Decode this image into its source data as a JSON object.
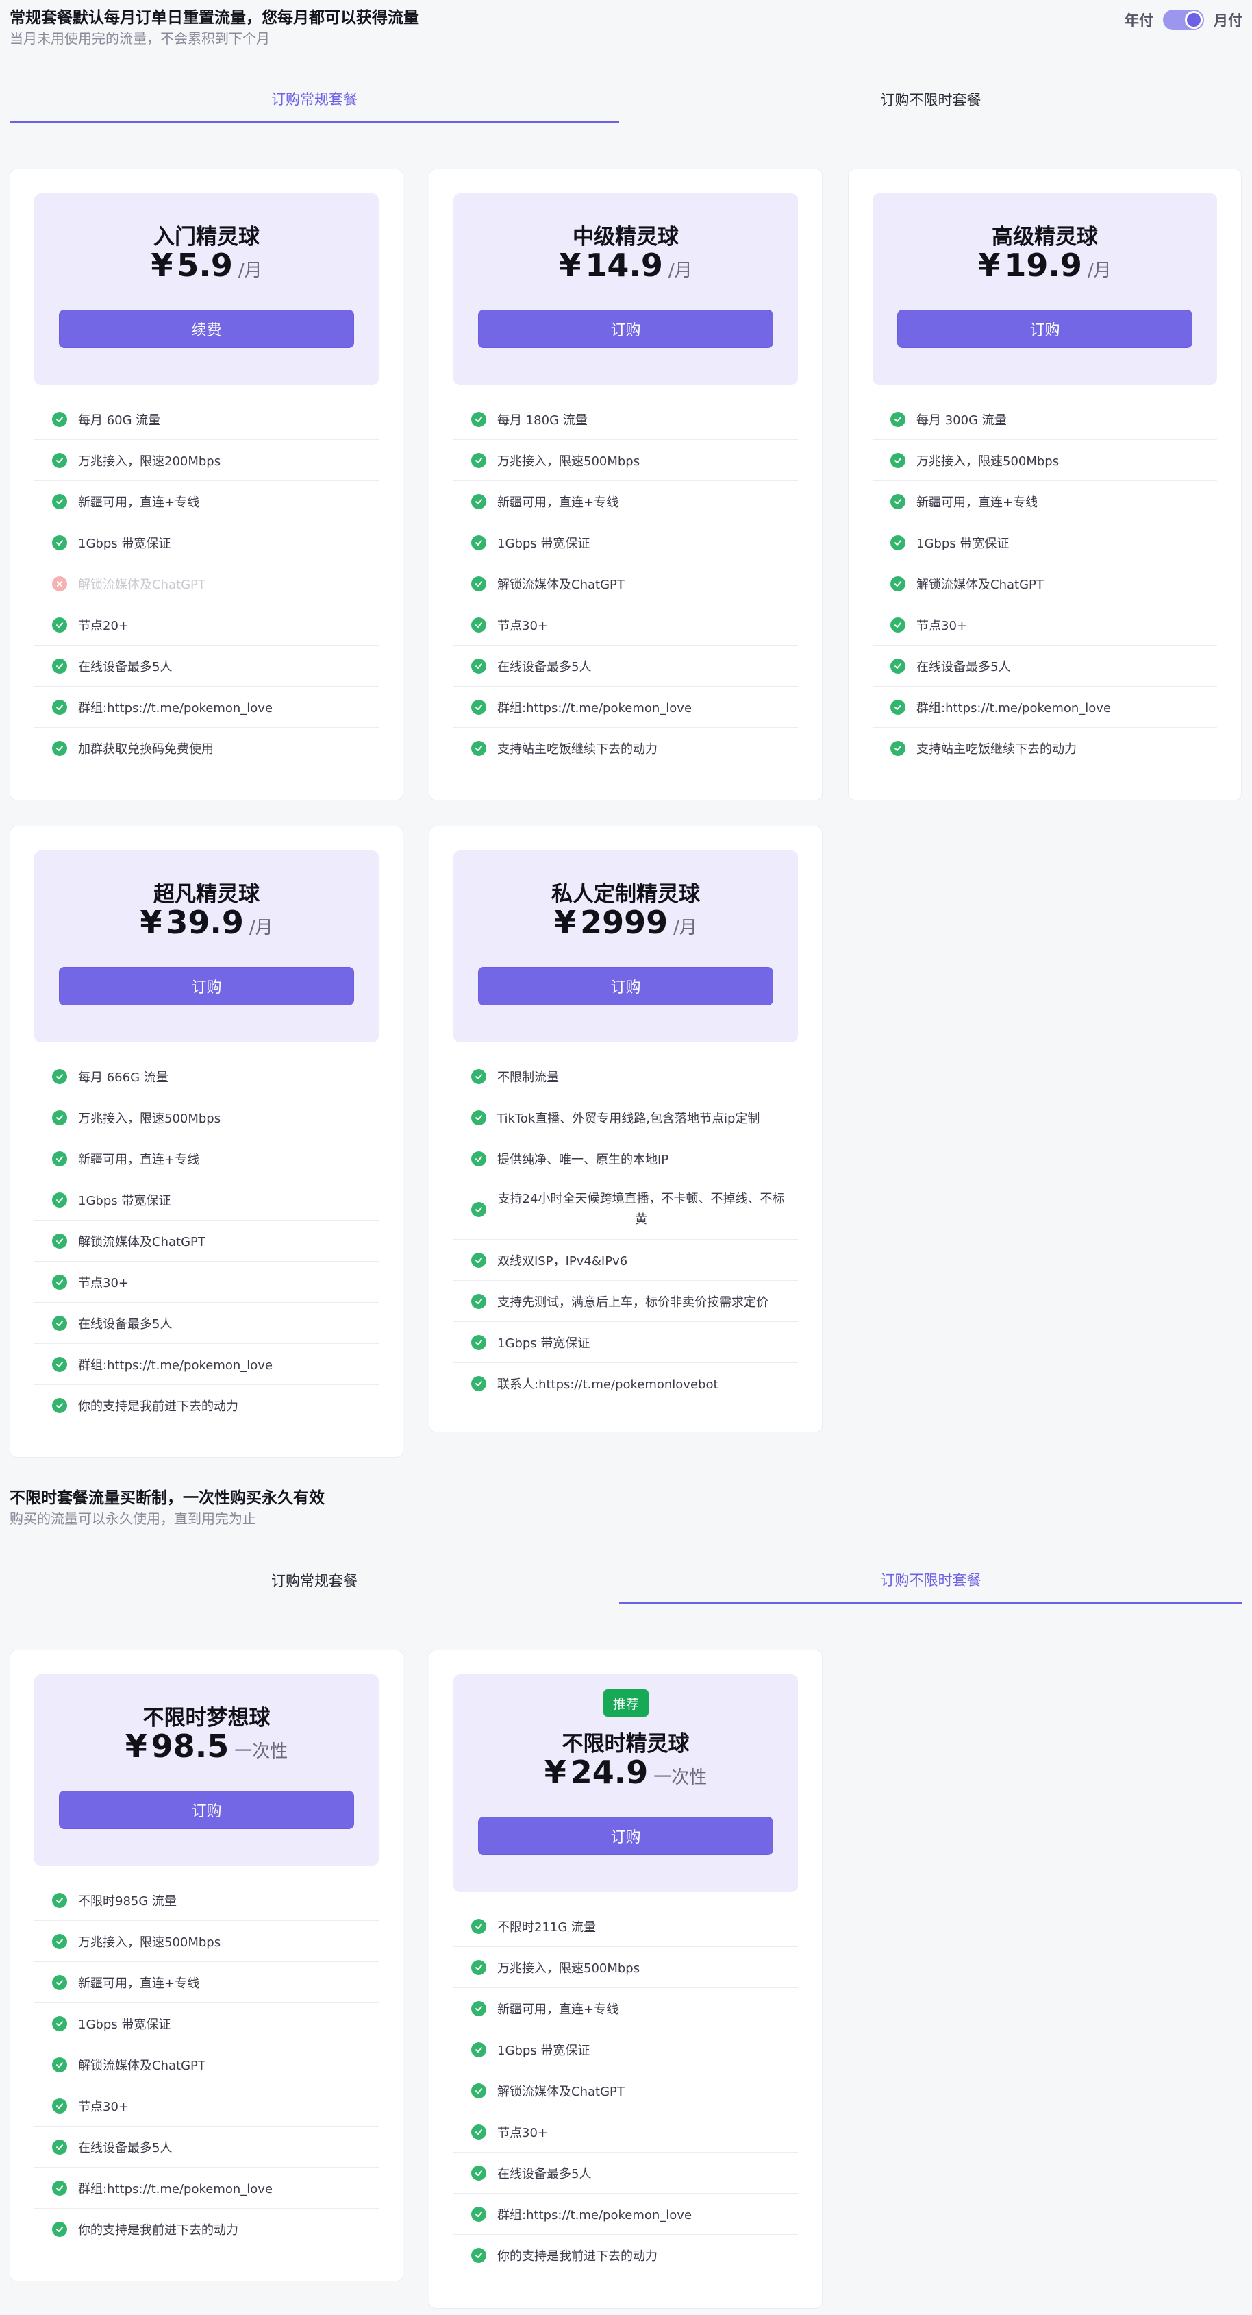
{
  "top": {
    "title": "常规套餐默认每月订单日重置流量，您每月都可以获得流量",
    "subtitle": "当月未用使用完的流量，不会累积到下个月",
    "toggle_left": "年付",
    "toggle_right": "月付"
  },
  "tabs": {
    "regular": "订购常规套餐",
    "unlimited": "订购不限时套餐"
  },
  "regular_plans": [
    {
      "name": "入门精灵球",
      "currency": "¥",
      "price": "5.9",
      "unit": "/月",
      "button": "续费",
      "features": [
        "每月 60G 流量",
        "万兆接入，限速200Mbps",
        "新疆可用，直连+专线",
        "1Gbps 带宽保证",
        "解锁流媒体及ChatGPT",
        "节点20+",
        "在线设备最多5人",
        "群组:https://t.me/pokemon_love",
        "加群获取兑换码免费使用"
      ],
      "disabled_feature": "解锁流媒体及ChatGPT"
    },
    {
      "name": "中级精灵球",
      "currency": "¥",
      "price": "14.9",
      "unit": "/月",
      "button": "订购",
      "features": [
        "每月 180G 流量",
        "万兆接入，限速500Mbps",
        "新疆可用，直连+专线",
        "1Gbps 带宽保证",
        "解锁流媒体及ChatGPT",
        "节点30+",
        "在线设备最多5人",
        "群组:https://t.me/pokemon_love",
        "支持站主吃饭继续下去的动力"
      ]
    },
    {
      "name": "高级精灵球",
      "currency": "¥",
      "price": "19.9",
      "unit": "/月",
      "button": "订购",
      "features": [
        "每月 300G 流量",
        "万兆接入，限速500Mbps",
        "新疆可用，直连+专线",
        "1Gbps 带宽保证",
        "解锁流媒体及ChatGPT",
        "节点30+",
        "在线设备最多5人",
        "群组:https://t.me/pokemon_love",
        "支持站主吃饭继续下去的动力"
      ]
    },
    {
      "name": "超凡精灵球",
      "currency": "¥",
      "price": "39.9",
      "unit": "/月",
      "button": "订购",
      "features": [
        "每月 666G 流量",
        "万兆接入，限速500Mbps",
        "新疆可用，直连+专线",
        "1Gbps 带宽保证",
        "解锁流媒体及ChatGPT",
        "节点30+",
        "在线设备最多5人",
        "群组:https://t.me/pokemon_love",
        "你的支持是我前进下去的动力"
      ]
    },
    {
      "name": "私人定制精灵球",
      "currency": "¥",
      "price": "2999",
      "unit": "/月",
      "button": "订购",
      "features": [
        "不限制流量",
        "TikTok直播、外贸专用线路,包含落地节点ip定制",
        "提供纯净、唯一、原生的本地IP",
        "支持24小时全天候跨境直播，不卡顿、不掉线、不标黄",
        "双线双ISP，IPv4&IPv6",
        "支持先测试，满意后上车，标价非卖价按需求定价",
        "1Gbps 带宽保证",
        "联系人:https://t.me/pokemonlovebot"
      ]
    }
  ],
  "unlimited_section": {
    "title": "不限时套餐流量买断制，一次性购买永久有效",
    "subtitle": "购买的流量可以永久使用，直到用完为止"
  },
  "unlimited_plans": [
    {
      "name": "不限时梦想球",
      "currency": "¥",
      "price": "98.5",
      "unit": "一次性",
      "button": "订购",
      "features": [
        "不限时985G 流量",
        "万兆接入，限速500Mbps",
        "新疆可用，直连+专线",
        "1Gbps 带宽保证",
        "解锁流媒体及ChatGPT",
        "节点30+",
        "在线设备最多5人",
        "群组:https://t.me/pokemon_love",
        "你的支持是我前进下去的动力"
      ]
    },
    {
      "name": "不限时精灵球",
      "badge": "推荐",
      "currency": "¥",
      "price": "24.9",
      "unit": "一次性",
      "button": "订购",
      "features": [
        "不限时211G 流量",
        "万兆接入，限速500Mbps",
        "新疆可用，直连+专线",
        "1Gbps 带宽保证",
        "解锁流媒体及ChatGPT",
        "节点30+",
        "在线设备最多5人",
        "群组:https://t.me/pokemon_love",
        "你的支持是我前进下去的动力"
      ]
    }
  ],
  "colors": {
    "accent": "#6d62e6",
    "check": "#34b56e",
    "cross": "#f6b2b2",
    "badge": "#18a957",
    "card_head_bg": "#edebfc"
  },
  "icons": {
    "check": "check-circle-icon",
    "cross": "x-circle-icon"
  }
}
